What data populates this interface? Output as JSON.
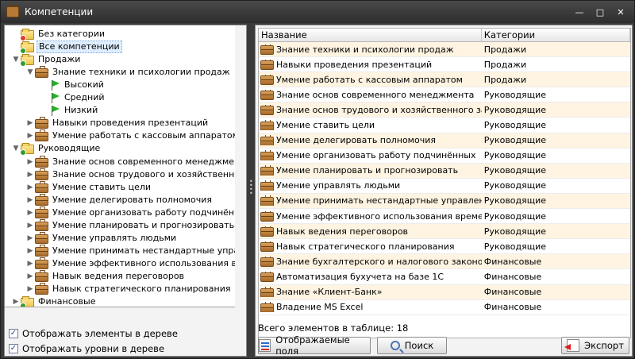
{
  "window": {
    "title": "Компетенции",
    "controls": [
      "—",
      "□",
      "✕"
    ]
  },
  "tree": {
    "rows": [
      {
        "label": "Без категории",
        "depth": 0,
        "icon": "folder-red",
        "expander": ""
      },
      {
        "label": "Все компетенции",
        "depth": 0,
        "icon": "folder-green",
        "expander": "",
        "selected": true
      },
      {
        "label": "Продажи",
        "depth": 0,
        "icon": "folder-green",
        "expander": "▼"
      },
      {
        "label": "Знание техники и психологии продаж",
        "depth": 1,
        "icon": "case",
        "expander": "▼"
      },
      {
        "label": "Высокий",
        "depth": 2,
        "icon": "flag",
        "expander": ""
      },
      {
        "label": "Средний",
        "depth": 2,
        "icon": "flag",
        "expander": ""
      },
      {
        "label": "Низкий",
        "depth": 2,
        "icon": "flag",
        "expander": ""
      },
      {
        "label": "Навыки проведения презентаций",
        "depth": 1,
        "icon": "case",
        "expander": "▶"
      },
      {
        "label": "Умение работать с кассовым аппаратом",
        "depth": 1,
        "icon": "case",
        "expander": "▶"
      },
      {
        "label": "Руководящие",
        "depth": 0,
        "icon": "folder-green",
        "expander": "▼"
      },
      {
        "label": "Знание основ современного менеджмента",
        "depth": 1,
        "icon": "case",
        "expander": "▶"
      },
      {
        "label": "Знание основ трудового и хозяйственного з",
        "depth": 1,
        "icon": "case",
        "expander": "▶"
      },
      {
        "label": "Умение ставить цели",
        "depth": 1,
        "icon": "case",
        "expander": "▶"
      },
      {
        "label": "Умение делегировать полномочия",
        "depth": 1,
        "icon": "case",
        "expander": "▶"
      },
      {
        "label": "Умение организовать работу подчинённых",
        "depth": 1,
        "icon": "case",
        "expander": "▶"
      },
      {
        "label": "Умение планировать и прогнозировать",
        "depth": 1,
        "icon": "case",
        "expander": "▶"
      },
      {
        "label": "Умение управлять людьми",
        "depth": 1,
        "icon": "case",
        "expander": "▶"
      },
      {
        "label": "Умение принимать нестандартные управле",
        "depth": 1,
        "icon": "case",
        "expander": "▶"
      },
      {
        "label": "Умение эффективного использования време",
        "depth": 1,
        "icon": "case",
        "expander": "▶"
      },
      {
        "label": "Навык ведения переговоров",
        "depth": 1,
        "icon": "case",
        "expander": "▶"
      },
      {
        "label": "Навык стратегического планирования",
        "depth": 1,
        "icon": "case",
        "expander": "▶"
      },
      {
        "label": "Финансовые",
        "depth": 0,
        "icon": "folder-green",
        "expander": "▶"
      }
    ],
    "scroll": {
      "up": "▲",
      "down": "▼"
    }
  },
  "options": {
    "show_elements": {
      "label": "Отображать элементы в дереве",
      "checked": "✓"
    },
    "show_levels": {
      "label": "Отображать уровни в дереве",
      "checked": "✓"
    }
  },
  "grid": {
    "headers": {
      "name": "Название",
      "category": "Категории"
    },
    "rows": [
      {
        "name": "Знание техники и психологии продаж",
        "category": "Продажи"
      },
      {
        "name": "Навыки проведения презентаций",
        "category": "Продажи"
      },
      {
        "name": "Умение работать с кассовым аппаратом",
        "category": "Продажи"
      },
      {
        "name": "Знание основ современного менеджмента",
        "category": "Руководящие"
      },
      {
        "name": "Знание основ трудового и хозяйственного законод",
        "category": "Руководящие"
      },
      {
        "name": "Умение ставить цели",
        "category": "Руководящие"
      },
      {
        "name": "Умение делегировать полномочия",
        "category": "Руководящие"
      },
      {
        "name": "Умение организовать работу подчинённых",
        "category": "Руководящие"
      },
      {
        "name": "Умение планировать и прогнозировать",
        "category": "Руководящие"
      },
      {
        "name": "Умение управлять людьми",
        "category": "Руководящие"
      },
      {
        "name": "Умение принимать нестандартные управленческие",
        "category": "Руководящие"
      },
      {
        "name": "Умение эффективного использования времени",
        "category": "Руководящие"
      },
      {
        "name": "Навык ведения переговоров",
        "category": "Руководящие"
      },
      {
        "name": "Навык стратегического планирования",
        "category": "Руководящие"
      },
      {
        "name": "Знание бухгалтерского и налогового законодател",
        "category": "Финансовые"
      },
      {
        "name": "Автоматизация бухучета на базе 1С",
        "category": "Финансовые"
      },
      {
        "name": "Знание «Клиент-Банк»",
        "category": "Финансовые"
      },
      {
        "name": "Владение MS Excel",
        "category": "Финансовые"
      }
    ],
    "total_label": "Всего элементов в таблице: 18"
  },
  "buttons": {
    "fields": "Отображаемые поля",
    "search": "Поиск",
    "export": "Экспорт"
  }
}
